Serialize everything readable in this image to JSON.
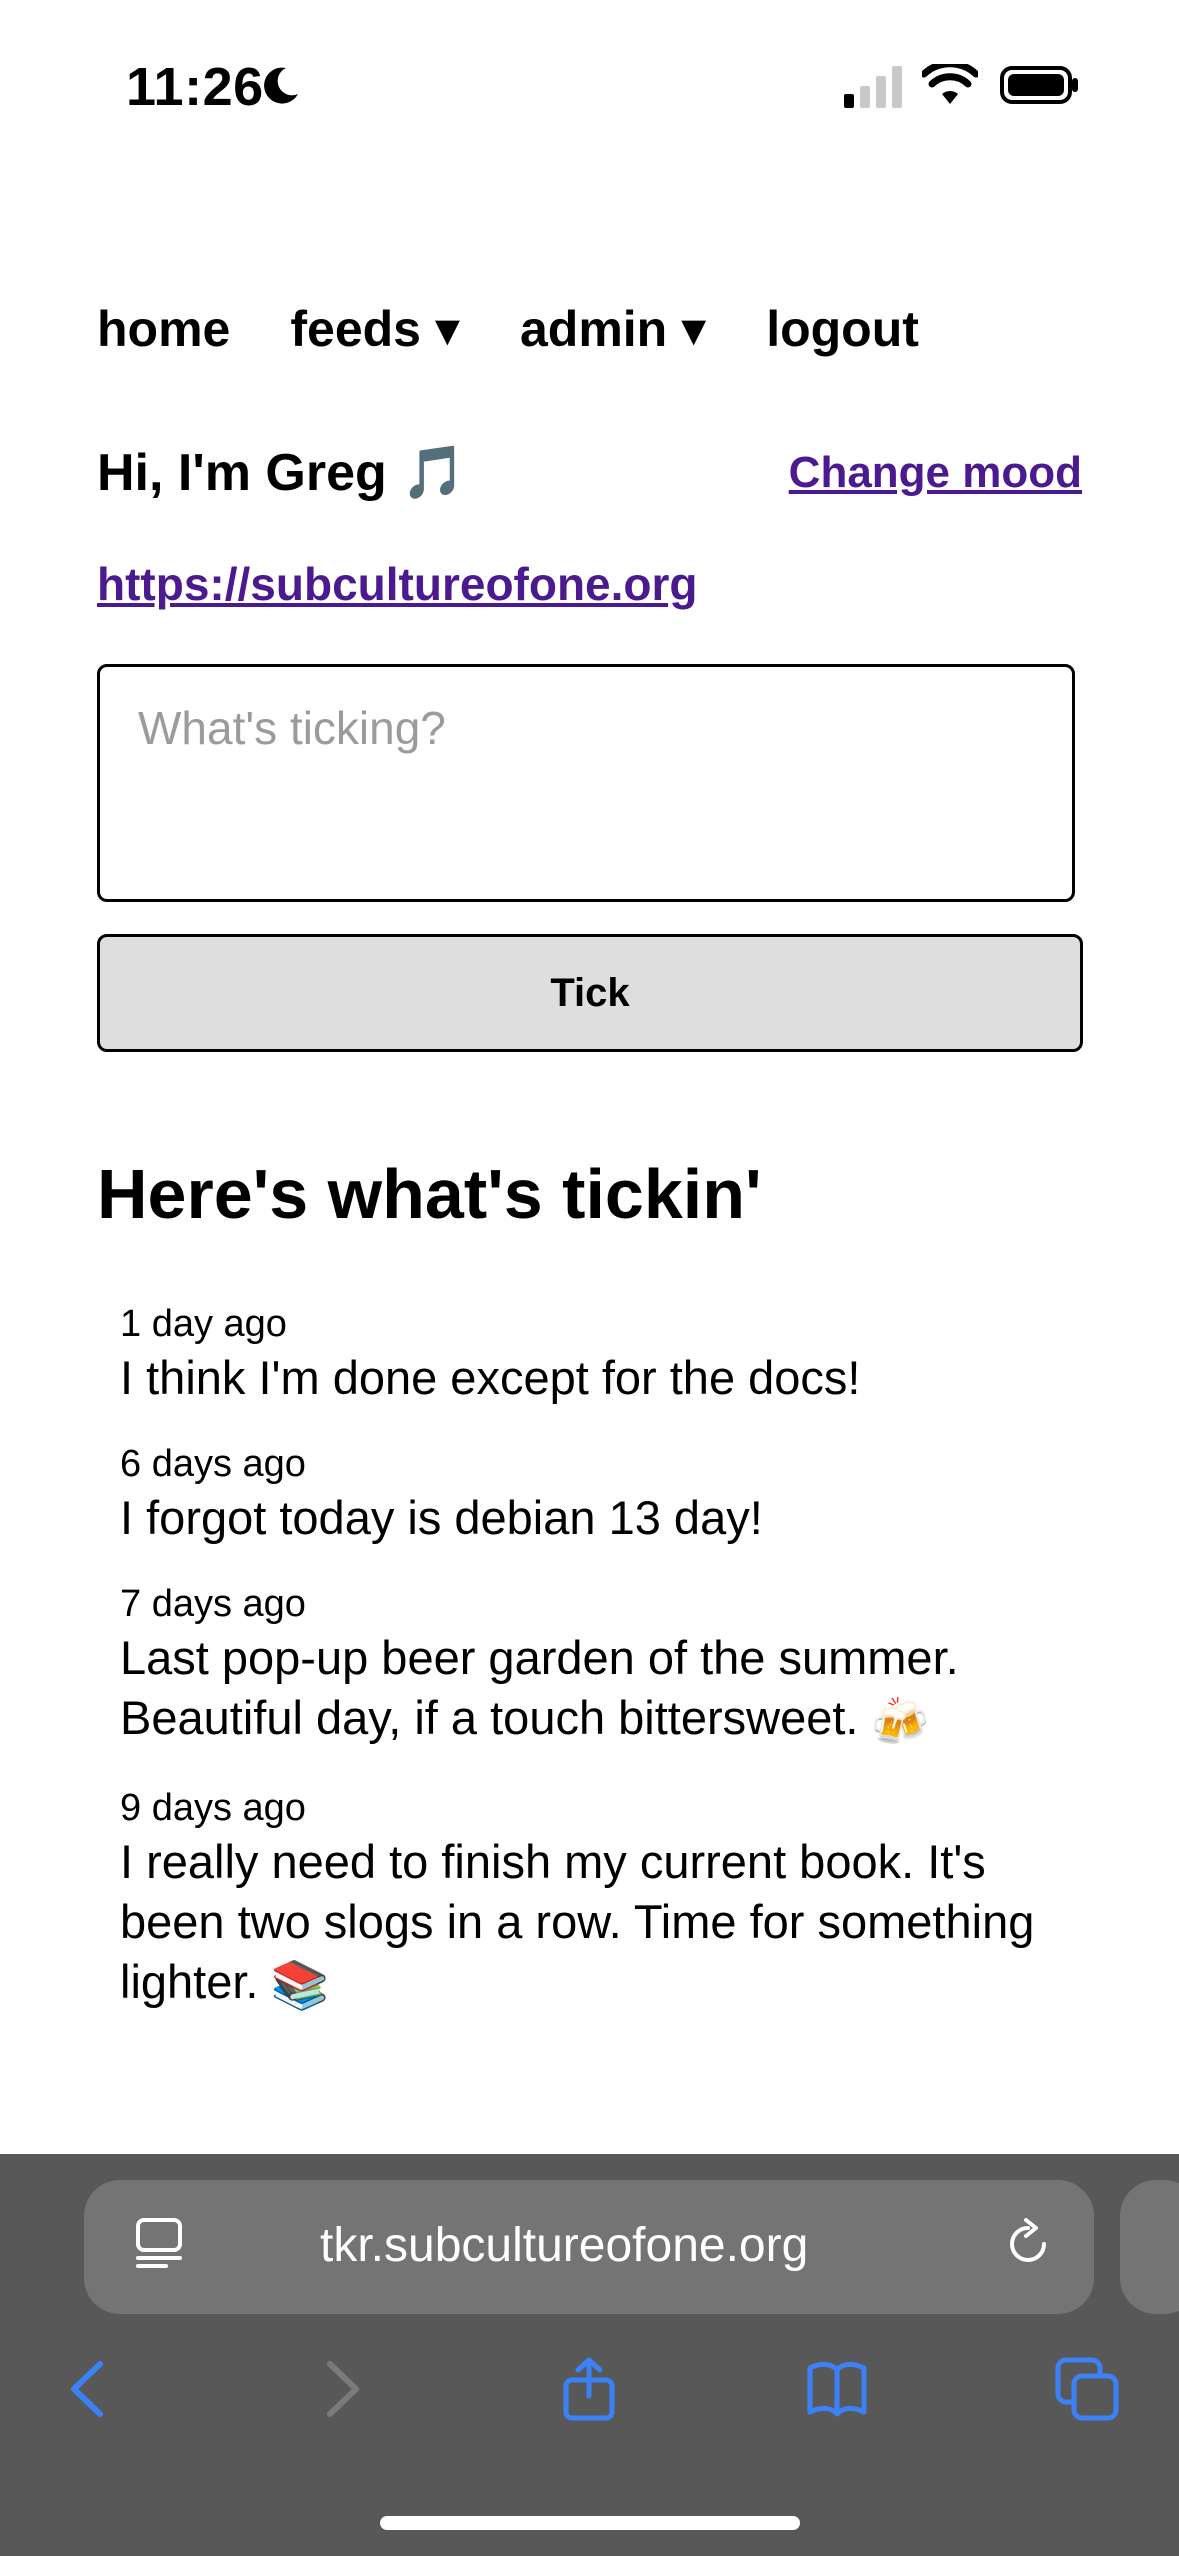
{
  "status_bar": {
    "time": "11:26"
  },
  "nav": {
    "items": [
      "home",
      "feeds ▾",
      "admin ▾",
      "logout"
    ]
  },
  "header": {
    "greeting": "Hi, I'm Greg 🎵",
    "change_mood": "Change mood",
    "site_link": "https://subcultureofone.org"
  },
  "composer": {
    "placeholder": "What's ticking?",
    "button_label": "Tick"
  },
  "section_title": "Here's what's tickin'",
  "ticks": [
    {
      "time": "1 day ago",
      "text": "I think I'm done except for the docs!",
      "emoji": ""
    },
    {
      "time": "6 days ago",
      "text": "I forgot today is debian 13 day!",
      "emoji": ""
    },
    {
      "time": "7 days ago",
      "text": "Last pop-up beer garden of the summer. Beautiful day, if a touch bittersweet.",
      "emoji": "🍻"
    },
    {
      "time": "9 days ago",
      "text": "I really need to finish my current book. It's been two slogs in a row. Time for something lighter.",
      "emoji": "📚"
    }
  ],
  "browser": {
    "url": "tkr.subcultureofone.org",
    "icons": [
      "reader-icon",
      "reload-icon",
      "back-icon",
      "forward-icon",
      "share-icon",
      "bookmarks-icon",
      "tabs-icon"
    ],
    "accent": "#3b82f6"
  }
}
